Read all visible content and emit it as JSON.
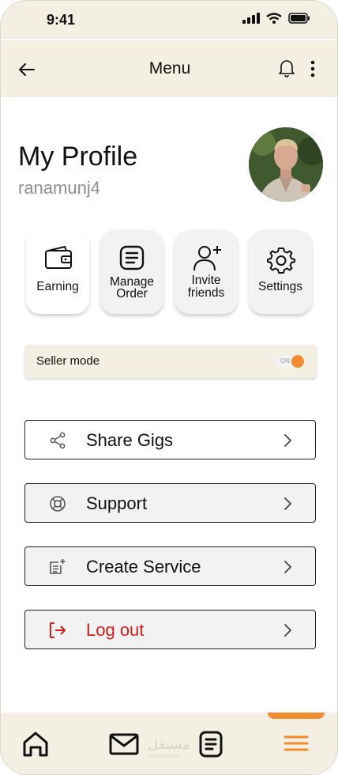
{
  "status_bar": {
    "time": "9:41"
  },
  "header": {
    "title": "Menu",
    "back_icon": "arrow-left-icon",
    "notification_icon": "bell-icon",
    "more_icon": "vertical-dots-icon"
  },
  "profile": {
    "name": "My Profile",
    "handle": "ranamunj4"
  },
  "quick_actions": [
    {
      "line1": "Earning",
      "line2": "",
      "icon": "wallet-icon"
    },
    {
      "line1": "Manage",
      "line2": "Order",
      "icon": "document-list-icon"
    },
    {
      "line1": "Invite",
      "line2": "friends",
      "icon": "add-user-icon"
    },
    {
      "line1": "Settings",
      "line2": "",
      "icon": "gear-icon"
    }
  ],
  "seller_mode": {
    "label": "Seller mode",
    "toggle_text": "ON",
    "enabled": true
  },
  "menu_items": [
    {
      "label": "Share Gigs",
      "icon": "share-icon"
    },
    {
      "label": "Support",
      "icon": "lifebuoy-icon"
    },
    {
      "label": "Create Service",
      "icon": "add-document-icon"
    },
    {
      "label": "Log out",
      "icon": "logout-icon"
    }
  ],
  "bottom_nav": {
    "items": [
      "home-icon",
      "mail-icon",
      "document-icon",
      "hamburger-menu-icon"
    ],
    "active": "hamburger-menu-icon",
    "watermark": "مستقل",
    "watermark_sub": "mostaql.com"
  },
  "colors": {
    "accent": "#f28a2e",
    "panel": "#f3efe2",
    "danger": "#d71d1d"
  }
}
